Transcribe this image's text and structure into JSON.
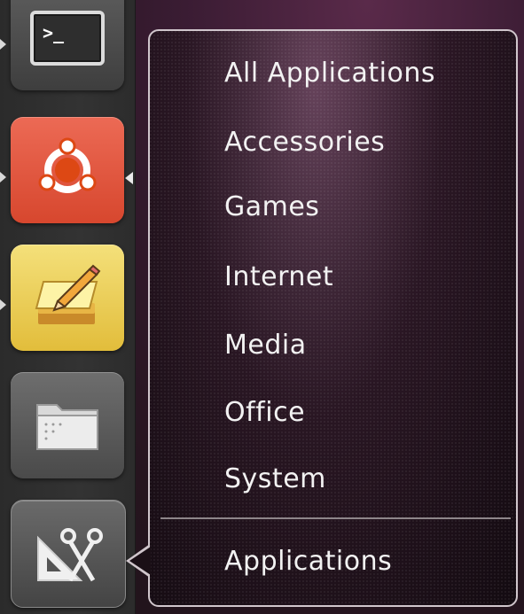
{
  "launcher": {
    "items": [
      {
        "name": "terminal",
        "icon": "terminal-icon",
        "color": "#4a4a4a"
      },
      {
        "name": "ubuntu-software-center",
        "icon": "ubuntu-logo-icon",
        "color": "#dd4814"
      },
      {
        "name": "tomboy-notes",
        "icon": "notes-pencil-icon",
        "color": "#e8c64a"
      },
      {
        "name": "files",
        "icon": "folder-icon",
        "color": "#5a5a5a"
      },
      {
        "name": "applications-lens",
        "icon": "applications-icon",
        "color": "#555555"
      }
    ]
  },
  "quicklist": {
    "items": [
      "All Applications",
      "Accessories",
      "Games",
      "Internet",
      "Media",
      "Office",
      "System"
    ],
    "title": "Applications"
  }
}
